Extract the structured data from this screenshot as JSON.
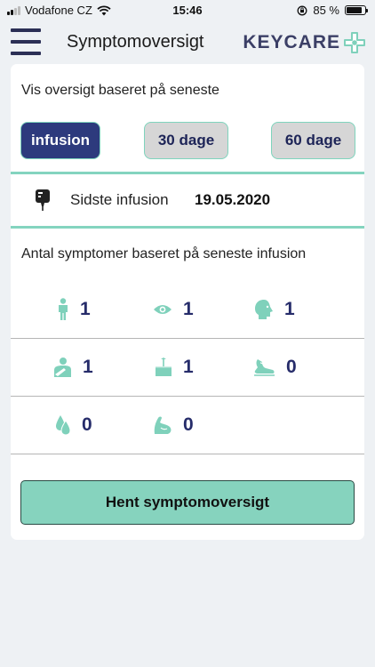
{
  "status_bar": {
    "carrier": "Vodafone CZ",
    "time": "15:46",
    "battery": "85 %",
    "battery_level": 0.85
  },
  "header": {
    "title": "Symptomoversigt",
    "logo_text": "KEYCARE"
  },
  "colors": {
    "accent_teal": "#84d4bf",
    "navy": "#2d3a7d",
    "number_navy": "#262c6a"
  },
  "overview": {
    "heading": "Vis oversigt baseret på seneste",
    "ranges": [
      {
        "label": "infusion",
        "active": true
      },
      {
        "label": "30 dage",
        "active": false
      },
      {
        "label": "60 dage",
        "active": false
      }
    ]
  },
  "last_infusion": {
    "icon": "iv-bag-icon",
    "label": "Sidste infusion",
    "date": "19.05.2020"
  },
  "symptoms": {
    "heading": "Antal symptomer baseret på seneste infusion",
    "rows": [
      [
        {
          "icon": "person-icon",
          "count": "1"
        },
        {
          "icon": "eye-icon",
          "count": "1"
        },
        {
          "icon": "head-icon",
          "count": "1"
        }
      ],
      [
        {
          "icon": "chest-pain-icon",
          "count": "1"
        },
        {
          "icon": "skin-icon",
          "count": "1"
        },
        {
          "icon": "foot-icon",
          "count": "0"
        }
      ],
      [
        {
          "icon": "drop-icon",
          "count": "0"
        },
        {
          "icon": "muscle-icon",
          "count": "0"
        }
      ]
    ]
  },
  "actions": {
    "fetch_label": "Hent symptomoversigt"
  }
}
